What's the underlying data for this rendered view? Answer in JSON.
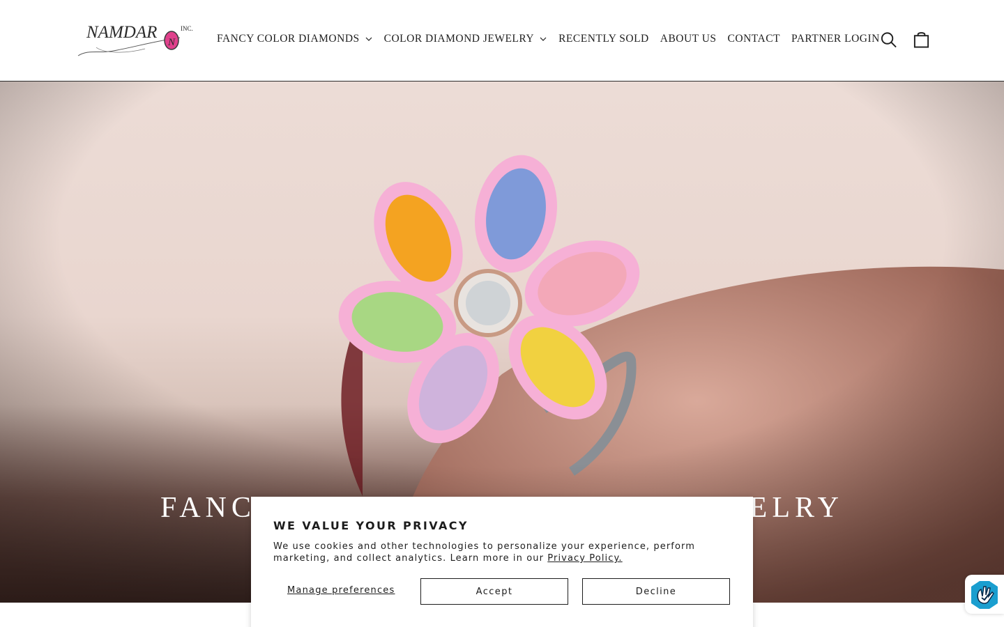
{
  "header": {
    "logo": {
      "brand": "NAMDAR",
      "suffix": "INC.",
      "monogram": "N",
      "icon": "namdar-logo"
    },
    "nav": [
      {
        "label": "FANCY COLOR DIAMONDS",
        "has_dropdown": true
      },
      {
        "label": "COLOR DIAMOND JEWELRY",
        "has_dropdown": true
      },
      {
        "label": "RECENTLY SOLD",
        "has_dropdown": false
      },
      {
        "label": "ABOUT US",
        "has_dropdown": false
      },
      {
        "label": "CONTACT",
        "has_dropdown": false
      },
      {
        "label": "PARTNER LOGIN",
        "has_dropdown": false
      }
    ],
    "icons": {
      "search": "search-icon",
      "cart": "cart-icon"
    }
  },
  "hero": {
    "title": "FANCY COLOR DIAMONDS & JEWELRY",
    "image": "flower-ring-with-colored-diamonds"
  },
  "cookie": {
    "title": "WE VALUE YOUR PRIVACY",
    "body": "We use cookies and other technologies to personalize your experience, perform marketing, and collect analytics. Learn more in our",
    "link": "Privacy Policy.",
    "manage": "Manage preferences",
    "accept": "Accept",
    "decline": "Decline"
  },
  "privacy_badge": {
    "icon": "privacy-hand-icon"
  },
  "colors": {
    "accent_pink": "#e0418c",
    "text": "#1c1c1c",
    "hero_bg": "#ecdcd6",
    "badge_blue": "#1a9ecf"
  }
}
